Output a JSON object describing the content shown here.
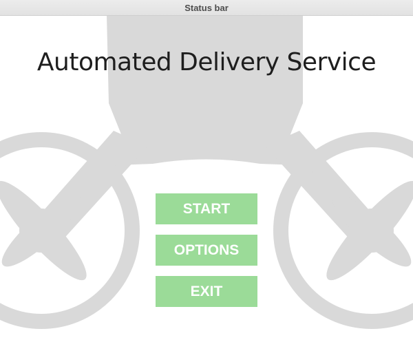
{
  "status_bar": {
    "title": "Status bar"
  },
  "main": {
    "title": "Automated Delivery Service"
  },
  "menu": {
    "buttons": [
      {
        "label": "START"
      },
      {
        "label": "OPTIONS"
      },
      {
        "label": "EXIT"
      }
    ]
  },
  "colors": {
    "button_fill": "#9bdb98",
    "button_text": "#ffffff",
    "drone_silhouette": "#d9d9d9"
  },
  "icons": {
    "background": "drone-silhouette-icon"
  }
}
